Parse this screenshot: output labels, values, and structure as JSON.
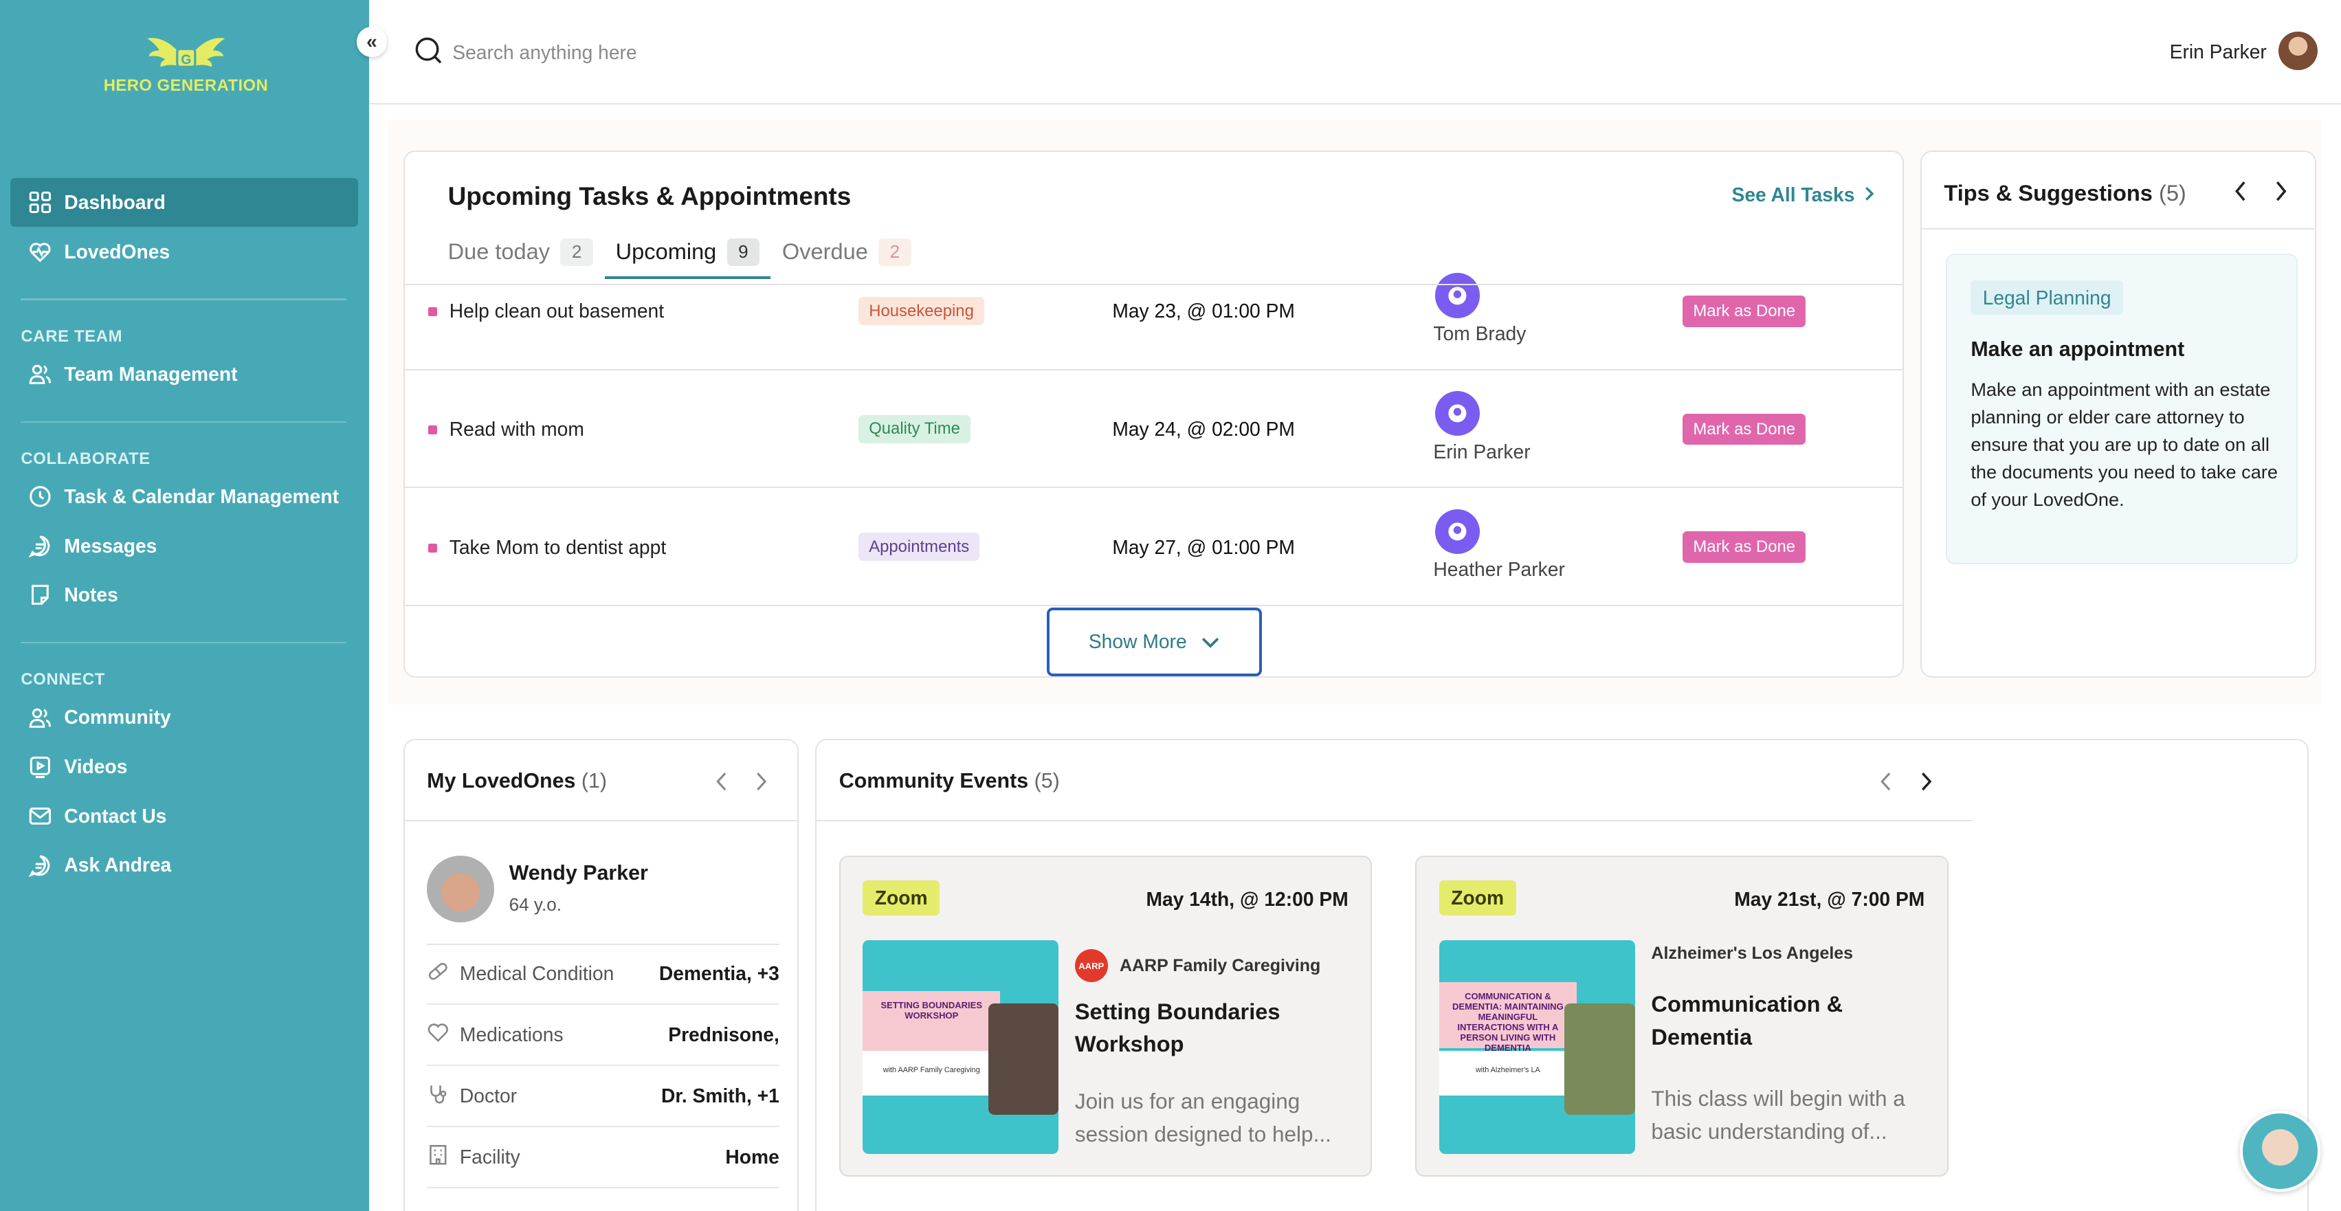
{
  "brand": {
    "name": "HERO GENERATION",
    "accent": "#47a9b6",
    "logo_color": "#e3ec63"
  },
  "sidebar": {
    "collapse_label": "«",
    "items": [
      {
        "label": "Dashboard",
        "icon": "grid-icon",
        "active": true
      },
      {
        "label": "LovedOnes",
        "icon": "heart-pulse-icon"
      }
    ],
    "sections": [
      {
        "title": "CARE TEAM",
        "items": [
          {
            "label": "Team Management",
            "icon": "users-icon"
          }
        ]
      },
      {
        "title": "COLLABORATE",
        "items": [
          {
            "label": "Task & Calendar Management",
            "icon": "clock-icon"
          },
          {
            "label": "Messages",
            "icon": "chat-icon"
          },
          {
            "label": "Notes",
            "icon": "note-icon"
          }
        ]
      },
      {
        "title": "CONNECT",
        "items": [
          {
            "label": "Community",
            "icon": "users-icon"
          },
          {
            "label": "Videos",
            "icon": "video-icon"
          },
          {
            "label": "Contact Us",
            "icon": "mail-icon"
          },
          {
            "label": "Ask Andrea",
            "icon": "chat-icon"
          }
        ]
      }
    ]
  },
  "topbar": {
    "search_placeholder": "Search anything here",
    "user_name": "Erin Parker"
  },
  "tasks": {
    "title": "Upcoming Tasks & Appointments",
    "see_all": "See All Tasks",
    "tabs": [
      {
        "label": "Due today",
        "count": "2"
      },
      {
        "label": "Upcoming",
        "count": "9",
        "active": true
      },
      {
        "label": "Overdue",
        "count": "2"
      }
    ],
    "rows": [
      {
        "name": "Help clean out basement",
        "category": "Housekeeping",
        "date": "May 23, @ 01:00 PM",
        "assignee": "Tom Brady",
        "action": "Mark as Done"
      },
      {
        "name": "Read with mom",
        "category": "Quality Time",
        "date": "May 24, @ 02:00 PM",
        "assignee": "Erin Parker",
        "action": "Mark as Done"
      },
      {
        "name": "Take Mom to dentist appt",
        "category": "Appointments",
        "date": "May 27, @ 01:00 PM",
        "assignee": "Heather Parker",
        "action": "Mark as Done"
      }
    ],
    "show_more": "Show More"
  },
  "tips": {
    "title": "Tips & Suggestions",
    "count": "(5)",
    "tag": "Legal Planning",
    "heading": "Make an appointment",
    "body": "Make an appointment with an estate planning or elder care attorney to ensure that you are up to date on all the documents you need to take care of your LovedOne."
  },
  "loved_ones": {
    "title": "My LovedOnes",
    "count": "(1)",
    "name": "Wendy Parker",
    "age": "64 y.o.",
    "fields": [
      {
        "label": "Medical Condition",
        "value": "Dementia, +3",
        "icon": "pill-icon"
      },
      {
        "label": "Medications",
        "value": "Prednisone,",
        "icon": "heart-icon"
      },
      {
        "label": "Doctor",
        "value": "Dr. Smith, +1",
        "icon": "stethoscope-icon"
      },
      {
        "label": "Facility",
        "value": "Home",
        "icon": "building-icon"
      }
    ]
  },
  "events": {
    "title": "Community Events",
    "count": "(5)",
    "items": [
      {
        "platform": "Zoom",
        "date": "May 14th, @ 12:00 PM",
        "org": "AARP Family Caregiving",
        "org_logo": "AARP",
        "title": "Setting Boundaries Workshop",
        "desc": "Join us for an engaging session designed to help...",
        "poster_title": "SETTING BOUNDARIES WORKSHOP",
        "poster_sub": "with AARP Family Caregiving"
      },
      {
        "platform": "Zoom",
        "date": "May 21st, @ 7:00 PM",
        "org": "Alzheimer's Los Angeles",
        "title": "Communication & Dementia",
        "desc": "This class will begin with a basic understanding of...",
        "poster_title": "COMMUNICATION & DEMENTIA: MAINTAINING MEANINGFUL INTERACTIONS WITH A PERSON LIVING WITH DEMENTIA",
        "poster_sub": "with Alzheimer's LA"
      }
    ]
  },
  "colors": {
    "pink": "#e066ac",
    "purple": "#7b5cf0",
    "zoom": "#e5ec6b"
  }
}
